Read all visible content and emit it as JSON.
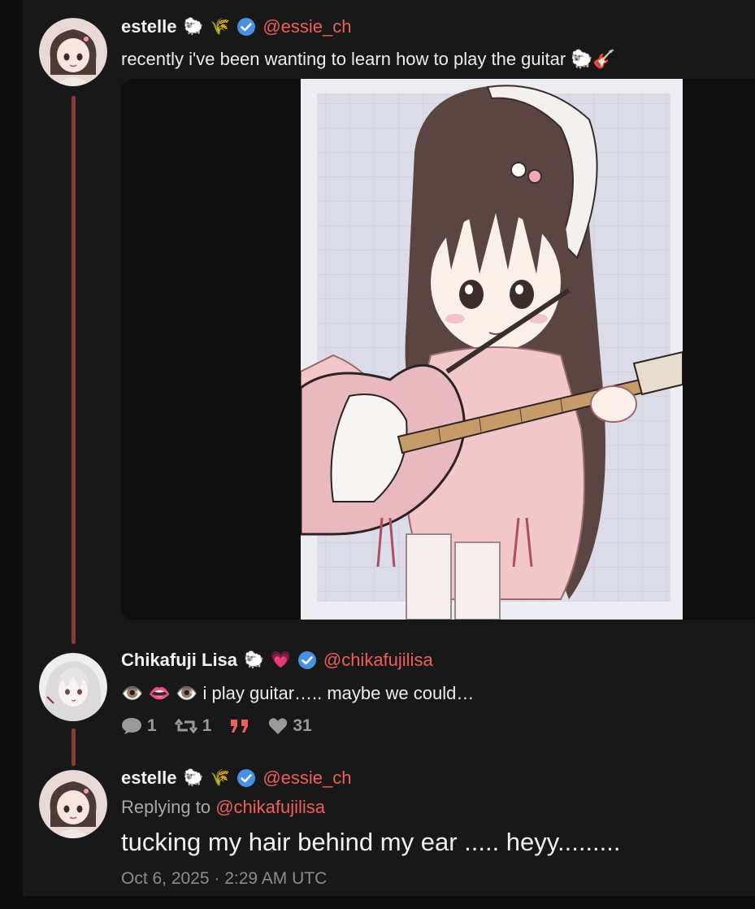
{
  "post1": {
    "author": "estelle",
    "author_emojis": [
      "🐑",
      "🌾"
    ],
    "handle": "@essie_ch",
    "text": "recently i've been wanting to learn how to play the guitar 🐑🎸",
    "media_description": "illustration of a girl with long brown hair playing an electric guitar"
  },
  "post2": {
    "author": "Chikafuji Lisa",
    "author_emojis": [
      "🐑",
      "💗"
    ],
    "handle": "@chikafujilisa",
    "text": "👁️  👄  👁️  i play guitar….. maybe we could…",
    "stats": {
      "replies": "1",
      "reposts": "1",
      "likes": "31"
    }
  },
  "post3": {
    "author": "estelle",
    "author_emojis": [
      "🐑",
      "🌾"
    ],
    "handle": "@essie_ch",
    "replying_prefix": "Replying to",
    "replying_handle": "@chikafujilisa",
    "text": "tucking my hair behind my ear ..... heyy.........",
    "timestamp": "Oct 6, 2025 · 2:29 AM UTC"
  },
  "colors": {
    "accent_handle": "#ee5e5a",
    "verified": "#4a90e2",
    "thread_line": "#8a3b39",
    "panel": "#181818"
  }
}
